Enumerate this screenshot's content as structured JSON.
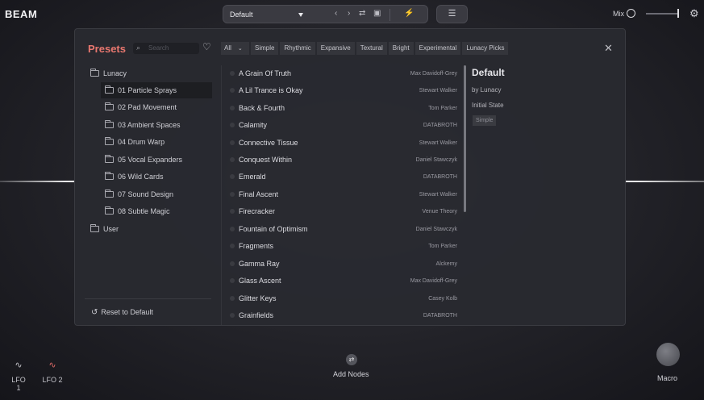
{
  "app": {
    "title": "BEAM"
  },
  "toolbar": {
    "preset_name": "Default",
    "prev_icon": "chevron-left-icon",
    "next_icon": "chevron-right-icon",
    "shuffle_icon": "shuffle-icon",
    "save_icon": "save-icon",
    "wand_icon": "magic-wand-icon",
    "settings_icon": "sliders-icon",
    "mix_label": "Mix"
  },
  "presets_panel": {
    "title": "Presets",
    "search_placeholder": "Search",
    "tags": [
      "Simple",
      "Rhythmic",
      "Expansive",
      "Textural",
      "Bright",
      "Experimental",
      "Lunacy Picks"
    ],
    "all_label": "All",
    "folders": [
      {
        "label": "Lunacy",
        "level": 0
      },
      {
        "label": "01 Particle Sprays",
        "level": 1,
        "selected": true
      },
      {
        "label": "02 Pad Movement",
        "level": 1
      },
      {
        "label": "03 Ambient Spaces",
        "level": 1
      },
      {
        "label": "04 Drum Warp",
        "level": 1
      },
      {
        "label": "05 Vocal Expanders",
        "level": 1
      },
      {
        "label": "06 Wild Cards",
        "level": 1
      },
      {
        "label": "07 Sound Design",
        "level": 1
      },
      {
        "label": "08 Subtle Magic",
        "level": 1
      },
      {
        "label": "User",
        "level": 0
      }
    ],
    "reset_label": "Reset to Default",
    "presets": [
      {
        "name": "A Grain Of Truth",
        "author": "Max Davidoff-Grey"
      },
      {
        "name": "A Lil Trance is Okay",
        "author": "Stewart Walker"
      },
      {
        "name": "Back & Fourth",
        "author": "Tom Parker"
      },
      {
        "name": "Calamity",
        "author": "DATABROTH"
      },
      {
        "name": "Connective Tissue",
        "author": "Stewart Walker"
      },
      {
        "name": "Conquest Within",
        "author": "Daniel Stawczyk"
      },
      {
        "name": "Emerald",
        "author": "DATABROTH"
      },
      {
        "name": "Final Ascent",
        "author": "Stewart Walker"
      },
      {
        "name": "Firecracker",
        "author": "Venue Theory"
      },
      {
        "name": "Fountain of Optimism",
        "author": "Daniel Stawczyk"
      },
      {
        "name": "Fragments",
        "author": "Tom Parker"
      },
      {
        "name": "Gamma Ray",
        "author": "Alckemy"
      },
      {
        "name": "Glass Ascent",
        "author": "Max Davidoff-Grey"
      },
      {
        "name": "Glitter Keys",
        "author": "Casey Kolb"
      },
      {
        "name": "Grainfields",
        "author": "DATABROTH"
      }
    ],
    "detail": {
      "name": "Default",
      "by": "by Lunacy",
      "state": "Initial State",
      "tag": "Simple"
    }
  },
  "bottom": {
    "lfo1": "LFO 1",
    "lfo2": "LFO 2",
    "add_nodes": "Add Nodes",
    "macro": "Macro"
  },
  "colors": {
    "accent": "#e8776f",
    "panel_bg": "#292a30",
    "lfo2_wave": "#e06a66"
  }
}
